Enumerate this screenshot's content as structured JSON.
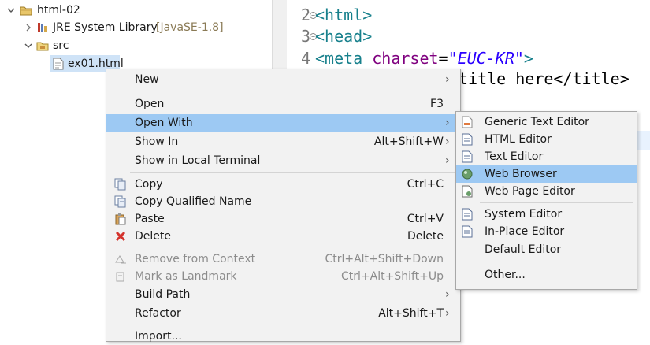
{
  "explorer": {
    "project": "html-02",
    "jre_label": "JRE System Library",
    "jre_version": "[JavaSE-1.8]",
    "src": "src",
    "file": "ex01.html"
  },
  "editor": {
    "lines": [
      {
        "num": "2",
        "text": "<html>"
      },
      {
        "num": "3",
        "text": "<head>"
      },
      {
        "num": "4",
        "parts": [
          "<meta ",
          "charset",
          "=",
          "\"EUC-KR\"",
          ">"
        ]
      },
      {
        "partial": "title here</title>"
      }
    ]
  },
  "context_menu": {
    "items": [
      {
        "label": "New",
        "shortcut": "",
        "submenu": true
      },
      {
        "label": "Open",
        "shortcut": "F3"
      },
      {
        "label": "Open With",
        "shortcut": "",
        "submenu": true,
        "highlighted": true
      },
      {
        "label": "Show In",
        "shortcut": "Alt+Shift+W",
        "submenu": true
      },
      {
        "label": "Show in Local Terminal",
        "shortcut": "",
        "submenu": true
      },
      {
        "label": "Copy",
        "shortcut": "Ctrl+C",
        "icon": "copy-icon"
      },
      {
        "label": "Copy Qualified Name",
        "shortcut": "",
        "icon": "copy-qualified-icon"
      },
      {
        "label": "Paste",
        "shortcut": "Ctrl+V",
        "icon": "paste-icon"
      },
      {
        "label": "Delete",
        "shortcut": "Delete",
        "icon": "delete-icon"
      },
      {
        "label": "Remove from Context",
        "shortcut": "Ctrl+Alt+Shift+Down",
        "disabled": true,
        "icon": "remove-context-icon"
      },
      {
        "label": "Mark as Landmark",
        "shortcut": "Ctrl+Alt+Shift+Up",
        "disabled": true,
        "icon": "landmark-icon"
      },
      {
        "label": "Build Path",
        "shortcut": "",
        "submenu": true
      },
      {
        "label": "Refactor",
        "shortcut": "Alt+Shift+T",
        "submenu": true
      },
      {
        "label": "Import...",
        "shortcut": ""
      }
    ]
  },
  "open_with_menu": {
    "items": [
      {
        "label": "Generic Text Editor",
        "icon": "generic-editor-icon"
      },
      {
        "label": "HTML Editor",
        "icon": "html-editor-icon"
      },
      {
        "label": "Text Editor",
        "icon": "text-editor-icon"
      },
      {
        "label": "Web Browser",
        "icon": "globe-icon",
        "highlighted": true
      },
      {
        "label": "Web Page Editor",
        "icon": "web-page-editor-icon"
      },
      {
        "label": "System Editor",
        "icon": "system-editor-icon"
      },
      {
        "label": "In-Place Editor",
        "icon": "in-place-editor-icon"
      },
      {
        "label": "Default Editor"
      },
      {
        "label": "Other..."
      }
    ]
  },
  "colors": {
    "menu_highlight": "#9dc9f3",
    "menu_bg": "#f2f2f2",
    "tag": "#17808c",
    "attr": "#7f007f",
    "string": "#2a00ff"
  }
}
